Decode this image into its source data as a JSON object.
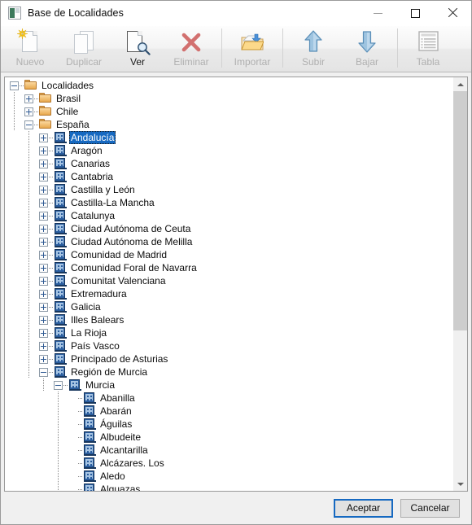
{
  "window": {
    "title": "Base de Localidades",
    "icon": "app-icon",
    "controls": {
      "minimize": "minimize",
      "maximize": "maximize",
      "close": "close"
    }
  },
  "toolbar": {
    "groups": [
      {
        "buttons": [
          {
            "label": "Nuevo",
            "icon": "new-document-icon",
            "enabled": false
          },
          {
            "label": "Duplicar",
            "icon": "duplicate-icon",
            "enabled": false
          },
          {
            "label": "Ver",
            "icon": "view-magnifier-icon",
            "enabled": true
          },
          {
            "label": "Eliminar",
            "icon": "delete-x-icon",
            "enabled": false
          }
        ]
      },
      {
        "buttons": [
          {
            "label": "Importar",
            "icon": "import-folder-icon",
            "enabled": false
          }
        ]
      },
      {
        "buttons": [
          {
            "label": "Subir",
            "icon": "arrow-up-icon",
            "enabled": false
          },
          {
            "label": "Bajar",
            "icon": "arrow-down-icon",
            "enabled": false
          }
        ]
      },
      {
        "buttons": [
          {
            "label": "Tabla",
            "icon": "table-icon",
            "enabled": false
          }
        ]
      }
    ]
  },
  "tree": {
    "nodes": [
      {
        "label": "Localidades",
        "depth": 0,
        "icon": "folder-icon",
        "expander": "minus",
        "selected": false
      },
      {
        "label": "Brasil",
        "depth": 1,
        "icon": "folder-icon",
        "expander": "plus",
        "selected": false
      },
      {
        "label": "Chile",
        "depth": 1,
        "icon": "folder-icon",
        "expander": "plus",
        "selected": false
      },
      {
        "label": "España",
        "depth": 1,
        "icon": "folder-icon",
        "expander": "minus",
        "selected": false
      },
      {
        "label": "Andalucía",
        "depth": 2,
        "icon": "region-icon",
        "expander": "plus",
        "selected": true
      },
      {
        "label": "Aragón",
        "depth": 2,
        "icon": "region-icon",
        "expander": "plus",
        "selected": false
      },
      {
        "label": "Canarias",
        "depth": 2,
        "icon": "region-icon",
        "expander": "plus",
        "selected": false
      },
      {
        "label": "Cantabria",
        "depth": 2,
        "icon": "region-icon",
        "expander": "plus",
        "selected": false
      },
      {
        "label": "Castilla y León",
        "depth": 2,
        "icon": "region-icon",
        "expander": "plus",
        "selected": false
      },
      {
        "label": "Castilla-La Mancha",
        "depth": 2,
        "icon": "region-icon",
        "expander": "plus",
        "selected": false
      },
      {
        "label": "Catalunya",
        "depth": 2,
        "icon": "region-icon",
        "expander": "plus",
        "selected": false
      },
      {
        "label": "Ciudad Autónoma de Ceuta",
        "depth": 2,
        "icon": "region-icon",
        "expander": "plus",
        "selected": false
      },
      {
        "label": "Ciudad Autónoma de Melilla",
        "depth": 2,
        "icon": "region-icon",
        "expander": "plus",
        "selected": false
      },
      {
        "label": "Comunidad de Madrid",
        "depth": 2,
        "icon": "region-icon",
        "expander": "plus",
        "selected": false
      },
      {
        "label": "Comunidad Foral de Navarra",
        "depth": 2,
        "icon": "region-icon",
        "expander": "plus",
        "selected": false
      },
      {
        "label": "Comunitat Valenciana",
        "depth": 2,
        "icon": "region-icon",
        "expander": "plus",
        "selected": false
      },
      {
        "label": "Extremadura",
        "depth": 2,
        "icon": "region-icon",
        "expander": "plus",
        "selected": false
      },
      {
        "label": "Galicia",
        "depth": 2,
        "icon": "region-icon",
        "expander": "plus",
        "selected": false
      },
      {
        "label": "Illes Balears",
        "depth": 2,
        "icon": "region-icon",
        "expander": "plus",
        "selected": false
      },
      {
        "label": "La Rioja",
        "depth": 2,
        "icon": "region-icon",
        "expander": "plus",
        "selected": false
      },
      {
        "label": "País Vasco",
        "depth": 2,
        "icon": "region-icon",
        "expander": "plus",
        "selected": false
      },
      {
        "label": "Principado de Asturias",
        "depth": 2,
        "icon": "region-icon",
        "expander": "plus",
        "selected": false
      },
      {
        "label": "Región de Murcia",
        "depth": 2,
        "icon": "region-icon",
        "expander": "minus",
        "selected": false
      },
      {
        "label": "Murcia",
        "depth": 3,
        "icon": "province-icon",
        "expander": "minus",
        "selected": false
      },
      {
        "label": "Abanilla",
        "depth": 4,
        "icon": "locality-icon",
        "expander": "none",
        "selected": false
      },
      {
        "label": "Abarán",
        "depth": 4,
        "icon": "locality-icon",
        "expander": "none",
        "selected": false
      },
      {
        "label": "Águilas",
        "depth": 4,
        "icon": "locality-icon",
        "expander": "none",
        "selected": false
      },
      {
        "label": "Albudeite",
        "depth": 4,
        "icon": "locality-icon",
        "expander": "none",
        "selected": false
      },
      {
        "label": "Alcantarilla",
        "depth": 4,
        "icon": "locality-icon",
        "expander": "none",
        "selected": false
      },
      {
        "label": "Alcázares. Los",
        "depth": 4,
        "icon": "locality-icon",
        "expander": "none",
        "selected": false
      },
      {
        "label": "Aledo",
        "depth": 4,
        "icon": "locality-icon",
        "expander": "none",
        "selected": false
      },
      {
        "label": "Alguazas",
        "depth": 4,
        "icon": "locality-icon",
        "expander": "none",
        "selected": false
      }
    ],
    "scrollbar": {
      "thumb_top_pct": 0,
      "thumb_height_pct": 62
    }
  },
  "dialog_buttons": {
    "accept": "Aceptar",
    "cancel": "Cancelar"
  },
  "colors": {
    "selection": "#1669c1",
    "folder": "#e8a94e",
    "region": "#2a5d9e",
    "toolbar_disabled_text": "#b0b0b0"
  }
}
